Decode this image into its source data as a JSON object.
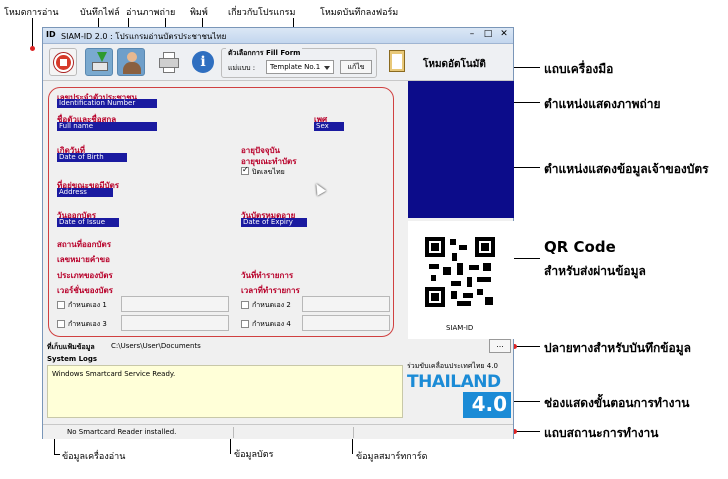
{
  "callouts": {
    "reader_mode": "โหมดการอ่าน",
    "save_file": "บันทึกไฟล์",
    "read_photo": "อ่านภาพถ่าย",
    "print": "พิมพ์",
    "about": "เกี่ยวกับโปรแกรม",
    "form_mode": "โหมดบันทึกลงฟอร์ม",
    "toolbar_desc": "แถบเครื่องมือ",
    "photo_desc": "ตำแหน่งแสดงภาพถ่าย",
    "cardinfo_desc": "ตำแหน่งแสดงข้อมูลเจ้าของบัตร",
    "qr_title": "QR Code",
    "qr_desc": "สำหรับส่งผ่านข้อมูล",
    "dest_desc": "ปลายทางสำหรับบันทึกข้อมูล",
    "log_desc": "ช่องแสดงขั้นตอนการทำงาน",
    "status_desc": "แถบสถานะการทำงาน",
    "reader_info": "ข้อมูลเครื่องอ่าน",
    "card_info": "ข้อมูลบัตร",
    "smartcard_info": "ข้อมูลสมาร์ทการ์ด"
  },
  "window": {
    "title": "SIAM-ID 2.0 : โปรแกรมอ่านบัตรประชาชนไทย",
    "minimize": "–",
    "maximize": "□",
    "close": "✕"
  },
  "toolbar": {
    "fill_form_label": "ตัวเลือกการ Fill Form",
    "template_label": "แม่แบบ :",
    "template_value": "Template No.1",
    "edit_button": "แก้ไข",
    "auto_mode": "โหมดอัตโนมัติ"
  },
  "fields": {
    "id_label": "เลขประจำตัวประชาชน",
    "id_en": "Identification Number",
    "name_label": "ชื่อตัวและชื่อสกุล",
    "name_en": "Full name",
    "sex_label": "เพศ",
    "sex_en": "Sex",
    "dob_label": "เกิดวันที่",
    "dob_en": "Date of Birth",
    "age_label": "อายุปัจจุบัน",
    "age_at_issue_label": "อายุขณะทำบัตร",
    "thai_digits_label": "ปิดเลขไทย",
    "address_label": "ที่อยู่ขณะขอมีบัตร",
    "address_en": "Address",
    "issue_label": "วันออกบัตร",
    "issue_en": "Date of Issue",
    "expiry_label": "วันบัตรหมดอายุ",
    "expiry_en": "Date of Expiry",
    "issue_place_label": "สถานที่ออกบัตร",
    "request_no_label": "เลขหมายคำขอ",
    "card_type_label": "ประเภทของบัตร",
    "trans_date_label": "วันที่ทำรายการ",
    "card_version_label": "เวอร์ชั่นของบัตร",
    "trans_time_label": "เวลาที่ทำรายการ",
    "custom1": "กำหนดเอง 1",
    "custom2": "กำหนดเอง 2",
    "custom3": "กำหนดเอง 3",
    "custom4": "กำหนดเอง 4"
  },
  "qr": {
    "caption": "SIAM-ID"
  },
  "storage": {
    "label": "ที่เก็บแฟ้มข้อมูล",
    "path": "C:\\Users\\User\\Documents",
    "browse": "..."
  },
  "logs": {
    "title": "System Logs",
    "line1": "Windows Smartcard Service Ready."
  },
  "promo": {
    "line": "ร่วมขับเคลื่อนประเทศไทย 4.0",
    "thailand": "THAILAND",
    "version": "4.0"
  },
  "status": {
    "reader": "No Smartcard Reader installed."
  },
  "colors": {
    "photo_bg": "#0c0c8a",
    "field_bg": "#1a1aa0",
    "label_red": "#b8002a",
    "log_bg": "#ffffd8",
    "thailand_blue": "#1b8bd6"
  }
}
